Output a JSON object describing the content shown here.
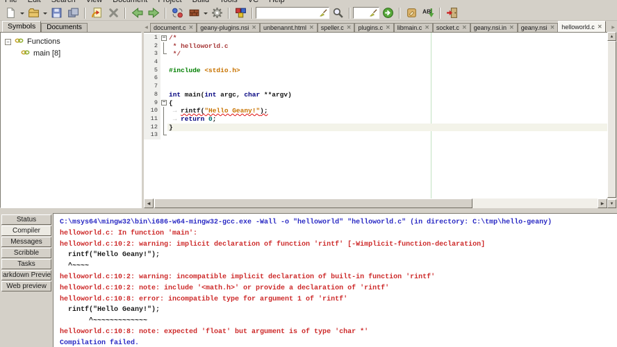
{
  "menubar": {
    "items": [
      "File",
      "Edit",
      "Search",
      "View",
      "Document",
      "Project",
      "Build",
      "Tools",
      "VC",
      "Help"
    ]
  },
  "toolbar": {
    "items": [
      {
        "type": "btn",
        "icon": "new-file",
        "name": "new-file",
        "dropdown": true
      },
      {
        "type": "btn",
        "icon": "open-folder",
        "name": "open-file",
        "dropdown": true
      },
      {
        "type": "btn",
        "icon": "save",
        "name": "save"
      },
      {
        "type": "btn",
        "icon": "save-all",
        "name": "save-all"
      },
      {
        "type": "sep"
      },
      {
        "type": "btn",
        "icon": "revert",
        "name": "revert"
      },
      {
        "type": "btn",
        "icon": "close",
        "name": "close-document"
      },
      {
        "type": "sep"
      },
      {
        "type": "btn",
        "icon": "nav-back",
        "name": "navigate-back"
      },
      {
        "type": "btn",
        "icon": "nav-forward",
        "name": "navigate-forward"
      },
      {
        "type": "sep"
      },
      {
        "type": "btn",
        "icon": "compile",
        "name": "compile"
      },
      {
        "type": "btn",
        "icon": "build",
        "name": "build",
        "dropdown": true
      },
      {
        "type": "btn",
        "icon": "run",
        "name": "run"
      },
      {
        "type": "sep"
      },
      {
        "type": "btn",
        "icon": "color-chooser",
        "name": "color-chooser"
      },
      {
        "type": "sep"
      },
      {
        "type": "entry",
        "name": "search-entry",
        "width": 106,
        "value": "",
        "placeholder": ""
      },
      {
        "type": "btn",
        "icon": "find",
        "name": "find"
      },
      {
        "type": "sep"
      },
      {
        "type": "entry",
        "name": "goto-line-entry",
        "width": 38,
        "value": "",
        "placeholder": ""
      },
      {
        "type": "btn",
        "icon": "goto-line",
        "name": "goto-line"
      },
      {
        "type": "sep"
      },
      {
        "type": "btn",
        "icon": "color-picker",
        "name": "color-picker"
      },
      {
        "type": "btn",
        "icon": "spellcheck",
        "name": "spellcheck"
      },
      {
        "type": "sep"
      },
      {
        "type": "btn",
        "icon": "quit",
        "name": "quit"
      }
    ]
  },
  "sidebar": {
    "tabs": [
      {
        "label": "Symbols",
        "active": true
      },
      {
        "label": "Documents",
        "active": false
      }
    ],
    "root_label": "Functions",
    "symbols": [
      "main [8]"
    ]
  },
  "file_tabs": [
    {
      "label": "document.c",
      "active": false
    },
    {
      "label": "geany-plugins.nsi",
      "active": false
    },
    {
      "label": "unbenannt.html",
      "active": false
    },
    {
      "label": "speller.c",
      "active": false
    },
    {
      "label": "plugins.c",
      "active": false
    },
    {
      "label": "libmain.c",
      "active": false
    },
    {
      "label": "socket.c",
      "active": false
    },
    {
      "label": "geany.nsi.in",
      "active": false
    },
    {
      "label": "geany.nsi",
      "active": false
    },
    {
      "label": "helloworld.c",
      "active": true
    }
  ],
  "editor": {
    "lines": [
      {
        "num": 1,
        "fold": "minus",
        "segs": [
          {
            "t": "/*",
            "s": "comment"
          }
        ]
      },
      {
        "num": 2,
        "fold": "guide",
        "segs": [
          {
            "t": " * helloworld.c",
            "s": "comment"
          }
        ]
      },
      {
        "num": 3,
        "fold": "corner",
        "segs": [
          {
            "t": " */",
            "s": "comment"
          }
        ]
      },
      {
        "num": 4,
        "fold": "",
        "segs": []
      },
      {
        "num": 5,
        "fold": "",
        "segs": [
          {
            "t": "#include ",
            "s": "preproc"
          },
          {
            "t": "<stdio.h>",
            "s": "strlit"
          }
        ]
      },
      {
        "num": 6,
        "fold": "",
        "segs": []
      },
      {
        "num": 7,
        "fold": "",
        "segs": []
      },
      {
        "num": 8,
        "fold": "",
        "segs": [
          {
            "t": "int",
            "s": "keyword"
          },
          {
            "t": " main(",
            "s": "plain"
          },
          {
            "t": "int",
            "s": "keyword"
          },
          {
            "t": " argc, ",
            "s": "plain"
          },
          {
            "t": "char",
            "s": "keyword"
          },
          {
            "t": " **argv)",
            "s": "plain"
          }
        ]
      },
      {
        "num": 9,
        "fold": "minus",
        "segs": [
          {
            "t": "{",
            "s": "plain"
          }
        ]
      },
      {
        "num": 10,
        "fold": "guide",
        "segs": [
          {
            "t": " → ",
            "s": "ws"
          },
          {
            "t": "rintf(",
            "s": "plain",
            "sq": true
          },
          {
            "t": "\"Hello Geany!\"",
            "s": "strlit",
            "sq": true
          },
          {
            "t": ");",
            "s": "plain",
            "sq": true
          }
        ]
      },
      {
        "num": 11,
        "fold": "guide",
        "segs": [
          {
            "t": " → ",
            "s": "ws"
          },
          {
            "t": "return",
            "s": "keyword"
          },
          {
            "t": " ",
            "s": "plain"
          },
          {
            "t": "0",
            "s": "number"
          },
          {
            "t": ";",
            "s": "plain"
          }
        ]
      },
      {
        "num": 12,
        "fold": "guide",
        "current": true,
        "segs": [
          {
            "t": "}",
            "s": "plain"
          }
        ]
      },
      {
        "num": 13,
        "fold": "corner",
        "segs": []
      }
    ]
  },
  "message_panel": {
    "tabs": [
      {
        "label": "Status",
        "active": false
      },
      {
        "label": "Compiler",
        "active": true
      },
      {
        "label": "Messages",
        "active": false
      },
      {
        "label": "Scribble",
        "active": false
      },
      {
        "label": "Tasks",
        "active": false
      },
      {
        "label": "Markdown Preview",
        "active": false
      },
      {
        "label": "Web preview",
        "active": false
      }
    ],
    "lines": [
      {
        "text": "C:\\msys64\\mingw32\\bin\\i686-w64-mingw32-gcc.exe -Wall -o \"helloworld\" \"helloworld.c\" (in directory: C:\\tmp\\hello-geany)",
        "color": "blue"
      },
      {
        "text": "helloworld.c: In function 'main':",
        "color": "red"
      },
      {
        "text": "helloworld.c:10:2: warning: implicit declaration of function 'rintf' [-Wimplicit-function-declaration]",
        "color": "red"
      },
      {
        "text": "  rintf(\"Hello Geany!\");",
        "color": "black"
      },
      {
        "text": "  ^~~~~",
        "color": "black"
      },
      {
        "text": "helloworld.c:10:2: warning: incompatible implicit declaration of built-in function 'rintf'",
        "color": "red"
      },
      {
        "text": "helloworld.c:10:2: note: include '<math.h>' or provide a declaration of 'rintf'",
        "color": "red"
      },
      {
        "text": "helloworld.c:10:8: error: incompatible type for argument 1 of 'rintf'",
        "color": "red"
      },
      {
        "text": "  rintf(\"Hello Geany!\");",
        "color": "black"
      },
      {
        "text": "       ^~~~~~~~~~~~~~",
        "color": "black"
      },
      {
        "text": "helloworld.c:10:8: note: expected 'float' but argument is of type 'char *'",
        "color": "red"
      },
      {
        "text": "Compilation failed.",
        "color": "blue"
      }
    ]
  },
  "colors": {
    "chrome": "#d4d0c8",
    "keyword": "#00007f",
    "comment": "#a83a3a",
    "string": "#c87300",
    "preprocessor": "#007f00",
    "error_squiggle": "#e01010",
    "msg_blue": "#2a2ac4",
    "msg_red": "#cd2a2a",
    "long_line_marker": "#c2e2c2"
  }
}
